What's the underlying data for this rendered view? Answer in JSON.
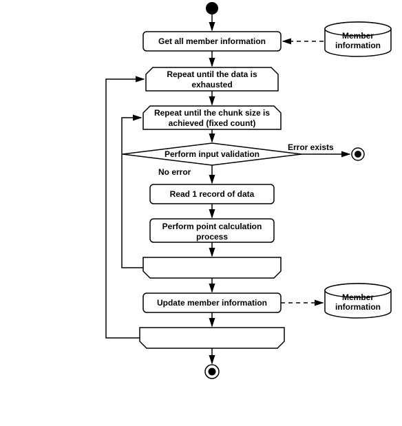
{
  "chart_data": {
    "type": "flowchart",
    "title": "",
    "nodes": [
      {
        "id": "start",
        "type": "initial",
        "label": ""
      },
      {
        "id": "get_info",
        "type": "process",
        "label": "Get all member information"
      },
      {
        "id": "loop1_head",
        "type": "loop_start",
        "label": "Repeat until the data is exhausted"
      },
      {
        "id": "loop2_head",
        "type": "loop_start",
        "label": "Repeat until the chunk size is achieved (fixed count)"
      },
      {
        "id": "decision",
        "type": "decision",
        "label": "Perform input validation"
      },
      {
        "id": "read",
        "type": "process",
        "label": "Read 1 record of data"
      },
      {
        "id": "calc",
        "type": "process",
        "label": "Perform point calculation process"
      },
      {
        "id": "loop2_tail",
        "type": "loop_end",
        "label": ""
      },
      {
        "id": "update",
        "type": "process",
        "label": "Update member information"
      },
      {
        "id": "loop1_tail",
        "type": "loop_end",
        "label": ""
      },
      {
        "id": "end",
        "type": "final",
        "label": ""
      },
      {
        "id": "err_end",
        "type": "final",
        "label": ""
      },
      {
        "id": "ds1",
        "type": "datastore",
        "label": "Member information"
      },
      {
        "id": "ds2",
        "type": "datastore",
        "label": "Member information"
      }
    ],
    "edges": [
      {
        "from": "start",
        "to": "get_info"
      },
      {
        "from": "get_info",
        "to": "loop1_head"
      },
      {
        "from": "loop1_head",
        "to": "loop2_head"
      },
      {
        "from": "loop2_head",
        "to": "decision"
      },
      {
        "from": "decision",
        "to": "read",
        "label": "No error"
      },
      {
        "from": "decision",
        "to": "err_end",
        "label": "Error exists"
      },
      {
        "from": "read",
        "to": "calc"
      },
      {
        "from": "calc",
        "to": "loop2_tail"
      },
      {
        "from": "loop2_tail",
        "to": "loop2_head",
        "back": true
      },
      {
        "from": "loop2_tail",
        "to": "update"
      },
      {
        "from": "update",
        "to": "loop1_tail"
      },
      {
        "from": "loop1_tail",
        "to": "loop1_head",
        "back": true
      },
      {
        "from": "loop1_tail",
        "to": "end"
      },
      {
        "from": "get_info",
        "to": "ds1",
        "style": "dashed"
      },
      {
        "from": "update",
        "to": "ds2",
        "style": "dashed"
      }
    ],
    "labels": {
      "no_error": "No error",
      "error_exists": "Error exists"
    }
  }
}
